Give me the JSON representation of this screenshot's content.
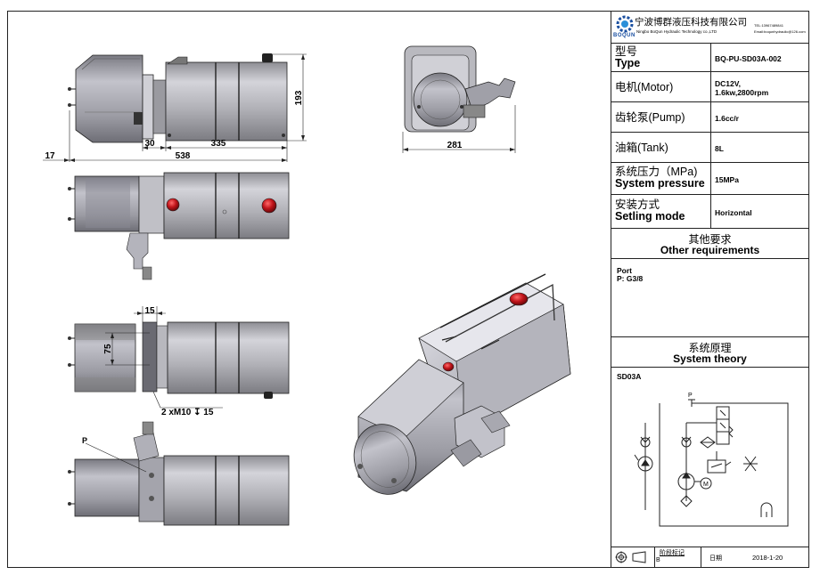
{
  "company": {
    "name_cn": "宁波博群液压科技有限公司",
    "name_en": "Ningbo BoQun Hydraulic Technology co.,LTD",
    "tel": "TEL:13967489841",
    "email": "Email:boqunhydraulic@126.com",
    "logo_text": "BOQUN",
    "logo_color": "#1a4fa0"
  },
  "specs": [
    {
      "key_cn": "型号",
      "key_en": "Type",
      "value": "BQ-PU-SD03A-002"
    },
    {
      "key_cn": "电机(Motor)",
      "key_en": "",
      "value": "DC12V,\n1.6kw,2800rpm"
    },
    {
      "key_cn": "齿轮泵(Pump)",
      "key_en": "",
      "value": "1.6cc/r"
    },
    {
      "key_cn": "油箱(Tank)",
      "key_en": "",
      "value": "8L"
    },
    {
      "key_cn": "系统压力（MPa)",
      "key_en": "System pressure",
      "value": "15MPa"
    },
    {
      "key_cn": "安装方式",
      "key_en": "Setling mode",
      "value": "Horizontal"
    }
  ],
  "other_requirements": {
    "title_cn": "其他要求",
    "title_en": "Other requirements",
    "line1": "Port",
    "line2": "P: G3/8"
  },
  "system_theory": {
    "title_cn": "系统原理",
    "title_en": "System theory",
    "code": "SD03A",
    "port_label": "P",
    "motor_label": "M"
  },
  "footer": {
    "stage_label": "阶段标记",
    "stage_value": "B",
    "date_label": "日期",
    "date_value": "2018-1-20"
  },
  "dimensions": {
    "d193": "193",
    "d30": "30",
    "d335": "335",
    "d17": "17",
    "d538": "538",
    "d281": "281",
    "d15": "15",
    "d75": "75",
    "thread_note": "2 xM10 ↧ 15",
    "port_p": "P"
  },
  "colors": {
    "body_fill": "#a8a8ad",
    "body_light": "#c9c9cf",
    "red_cap": "#c0141a",
    "line": "#222222"
  }
}
